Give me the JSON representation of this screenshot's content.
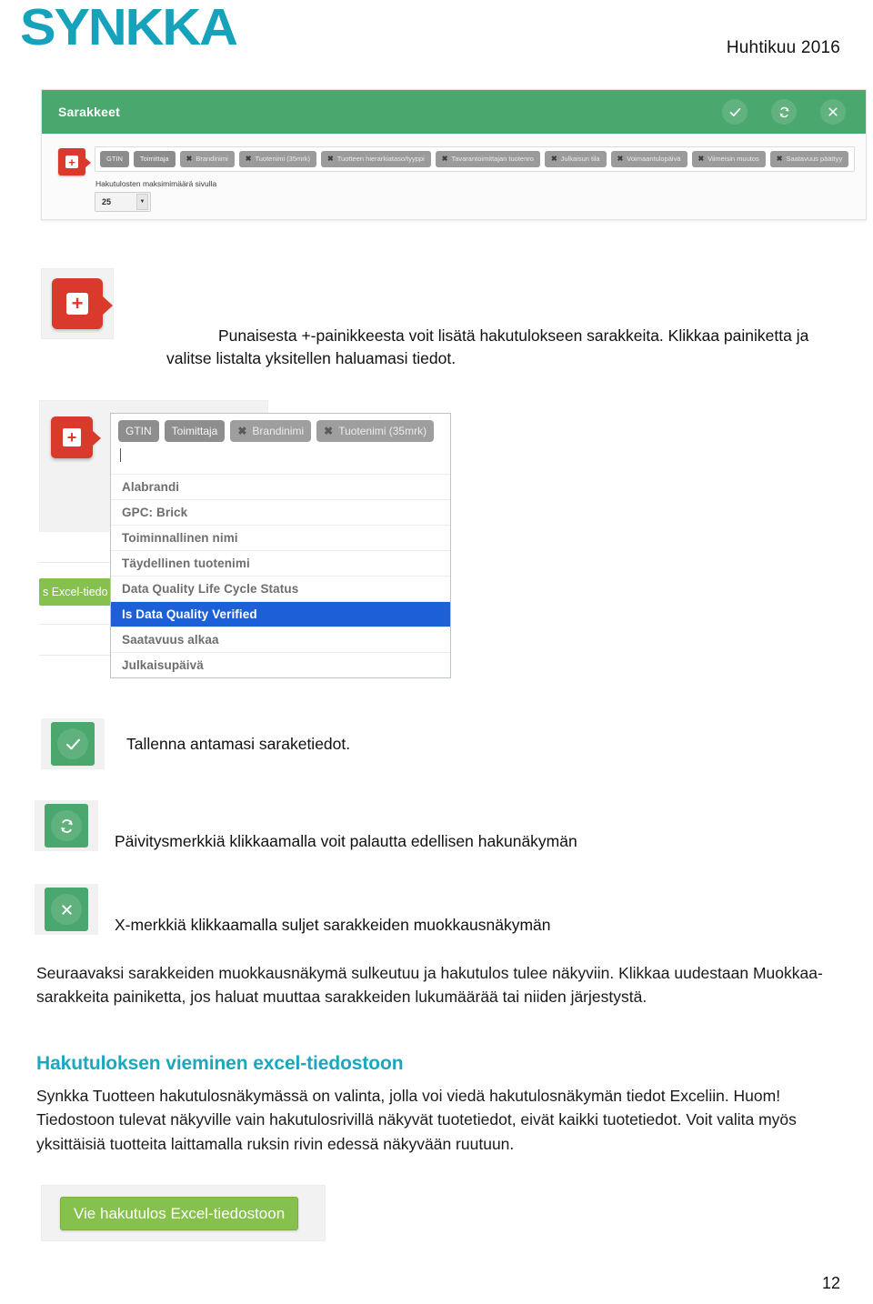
{
  "header": {
    "logo_text": "SYNKKA",
    "date": "Huhtikuu 2016",
    "logo_color": "#17a2bc"
  },
  "panel": {
    "title": "Sarakkeet",
    "header_color": "#4aa76d",
    "actions": [
      {
        "name": "check-icon",
        "label": "Tallenna"
      },
      {
        "name": "refresh-icon",
        "label": "Päivitä"
      },
      {
        "name": "close-icon",
        "label": "Sulje"
      }
    ],
    "add_button_glyph": "+",
    "chips": [
      {
        "label": "GTIN",
        "removable": false
      },
      {
        "label": "Toimittaja",
        "removable": false
      },
      {
        "label": "Brandinimi",
        "removable": true
      },
      {
        "label": "Tuotenimi (35mrk)",
        "removable": true
      },
      {
        "label": "Tuotteen hierarkiataso/tyyppi",
        "removable": true
      },
      {
        "label": "Tavarantoimittajan tuotenro",
        "removable": true
      },
      {
        "label": "Julkaisun tila",
        "removable": true
      },
      {
        "label": "Voimaantulopäivä",
        "removable": true
      },
      {
        "label": "Viimeisin muutos",
        "removable": true
      },
      {
        "label": "Saatavuus päättyy",
        "removable": true
      }
    ],
    "max_results_label": "Hakutulosten maksimimäärä sivulla",
    "max_results_value": "25"
  },
  "callout_plus": {
    "text": "Punaisesta +-painikkeesta voit lisätä hakutulokseen sarakkeita. Klikkaa painiketta ja valitse listalta yksitellen haluamasi tiedot."
  },
  "dropdown_shot": {
    "ghost_button_label": "s Excel-tiedo",
    "add_button_glyph": "+",
    "chips": [
      {
        "label": "GTIN",
        "removable": false
      },
      {
        "label": "Toimittaja",
        "removable": false
      },
      {
        "label": "Brandinimi",
        "removable": true
      },
      {
        "label": "Tuotenimi (35mrk)",
        "removable": true
      }
    ],
    "options": [
      {
        "label": "Alabrandi",
        "selected": false
      },
      {
        "label": "GPC: Brick",
        "selected": false
      },
      {
        "label": "Toiminnallinen nimi",
        "selected": false
      },
      {
        "label": "Täydellinen tuotenimi",
        "selected": false
      },
      {
        "label": "Data Quality Life Cycle Status",
        "selected": false
      },
      {
        "label": "Is Data Quality Verified",
        "selected": true
      },
      {
        "label": "Saatavuus alkaa",
        "selected": false
      },
      {
        "label": "Julkaisupäivä",
        "selected": false
      }
    ],
    "highlight_color": "#1d5fd6"
  },
  "callouts": {
    "save": "Tallenna antamasi saraketiedot.",
    "refresh": "Päivitysmerkkiä klikkaamalla voit palautta edellisen hakunäkymän",
    "close": "X-merkkiä klikkaamalla suljet sarakkeiden muokkausnäkymän"
  },
  "body": {
    "paragraph_seuraavaksi": "Seuraavaksi sarakkeiden muokkausnäkymä sulkeutuu ja hakutulos tulee näkyviin. Klikkaa uudestaan Muokkaa-sarakkeita painiketta, jos haluat muuttaa sarakkeiden lukumäärää tai niiden järjestystä.",
    "heading_excel": "Hakutuloksen vieminen excel-tiedostoon",
    "heading_color": "#19a8bd",
    "paragraph_excel": "Synkka Tuotteen hakutulosnäkymässä on valinta, jolla voi viedä hakutulosnäkymän tiedot Exceliin. Huom! Tiedostoon tulevat näkyville vain hakutulosrivillä näkyvät tuotetiedot, eivät kaikki tuotetiedot. Voit valita myös yksittäisiä tuotteita laittamalla ruksin rivin edessä näkyvään ruutuun."
  },
  "export": {
    "button_label": "Vie hakutulos Excel-tiedostoon",
    "button_color": "#86c14e"
  },
  "footer": {
    "page_number": "12"
  }
}
